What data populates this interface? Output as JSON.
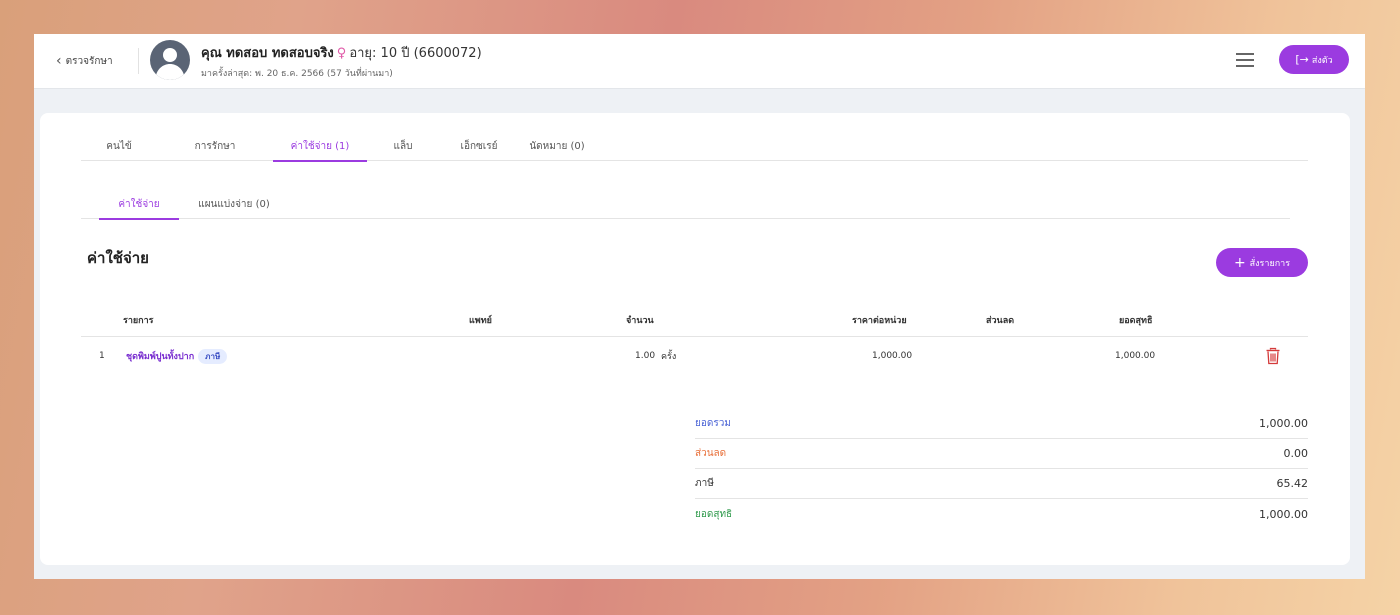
{
  "header": {
    "back_label": "ตรวจรักษา",
    "patient_name": "คุณ ทดสอบ ทดสอบจริง",
    "gender_symbol": "♀",
    "age_text": "อายุ: 10 ปี (6600072)",
    "last_visit": "มาครั้งล่าสุด: พ. 20 ธ.ค. 2566 (57 วันที่ผ่านมา)",
    "send_label": "ส่งตัว",
    "send_icon": "[→"
  },
  "tabs": [
    {
      "label": "คนไข้"
    },
    {
      "label": "การรักษา"
    },
    {
      "label": "ค่าใช้จ่าย (1)"
    },
    {
      "label": "แล็บ"
    },
    {
      "label": "เอ็กซเรย์"
    },
    {
      "label": "นัดหมาย (0)"
    }
  ],
  "subtabs": [
    {
      "label": "ค่าใช้จ่าย"
    },
    {
      "label": "แผนแบ่งจ่าย (0)"
    }
  ],
  "section": {
    "title": "ค่าใช้จ่าย",
    "order_label": "สั่งรายการ",
    "order_icon": "+"
  },
  "table": {
    "headers": {
      "item": "รายการ",
      "doctor": "แพทย์",
      "quantity": "จำนวน",
      "unit_price": "ราคาต่อหน่วย",
      "discount": "ส่วนลด",
      "net": "ยอดสุทธิ"
    },
    "rows": [
      {
        "index": "1",
        "item": "ชุดพิมพ์ปูนทั้งปาก",
        "badge": "ภาษี",
        "doctor": "",
        "quantity": "1.00",
        "unit": "ครั้ง",
        "unit_price": "1,000.00",
        "discount": "",
        "net": "1,000.00",
        "delete_icon": "trash-icon"
      }
    ]
  },
  "summary": [
    {
      "label": "ยอดรวม",
      "value": "1,000.00",
      "color": "#4a63d6"
    },
    {
      "label": "ส่วนลด",
      "value": "0.00",
      "color": "#e8703a"
    },
    {
      "label": "ภาษี",
      "value": "65.42",
      "color": "#333333"
    },
    {
      "label": "ยอดสุทธิ",
      "value": "1,000.00",
      "color": "#2f9a4c"
    }
  ],
  "colors": {
    "accent": "#9b3be0",
    "danger": "#d43a3a"
  }
}
